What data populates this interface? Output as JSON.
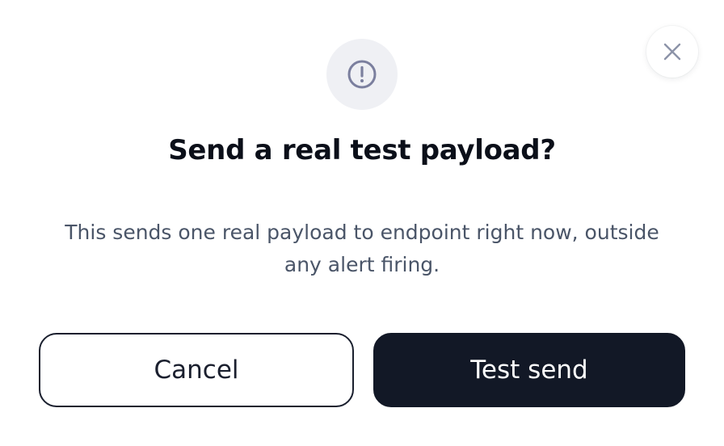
{
  "dialog": {
    "title": "Send a real test payload?",
    "message": "This sends one real payload to endpoint right now, outside any alert firing.",
    "header_icon": "alert-circle-icon",
    "close_icon": "close-icon",
    "cancel_label": "Cancel",
    "confirm_label": "Test send"
  },
  "colors": {
    "primary": "#121826",
    "icon_bg": "#eff0f4",
    "icon_stroke": "#7b7f9e",
    "body_text": "#4a5568"
  }
}
